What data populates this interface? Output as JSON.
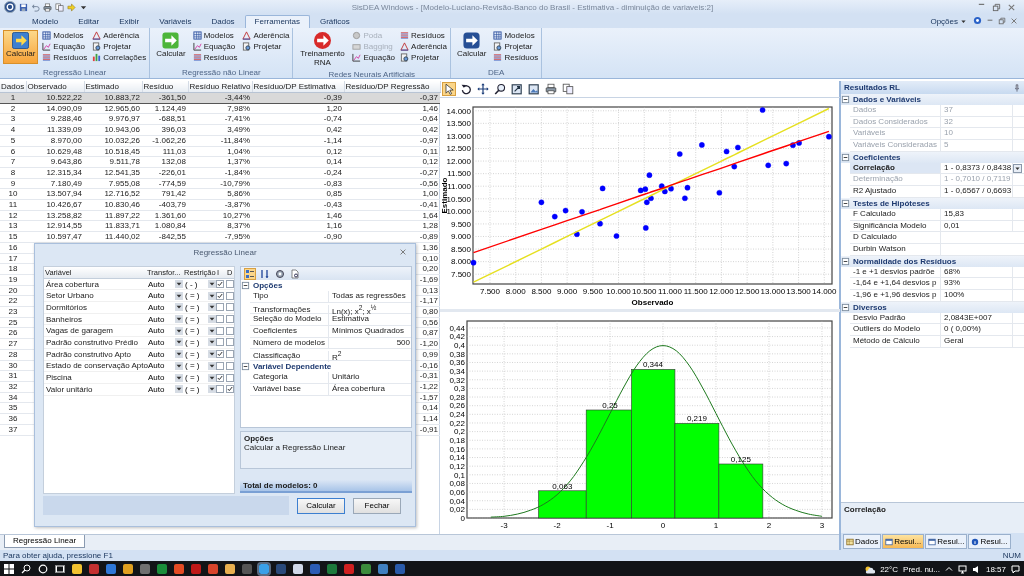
{
  "title_bar": {
    "title": "SisDEA Windows - [Modelo-Luciano-Revisão-Banco do Brasil - Estimativa - diminuição de variaveis:2]"
  },
  "ribbon": {
    "tabs": [
      {
        "label": "Modelo",
        "selected": false
      },
      {
        "label": "Editar",
        "selected": false
      },
      {
        "label": "Exibir",
        "selected": false
      },
      {
        "label": "Variáveis",
        "selected": false
      },
      {
        "label": "Dados",
        "selected": false
      },
      {
        "label": "Ferramentas",
        "selected": true
      },
      {
        "label": "Gráficos",
        "selected": false
      }
    ],
    "options_label": "Opções",
    "groups": [
      {
        "label": "Regressão Linear",
        "big": {
          "label": "Calcular",
          "kind": "square",
          "selected": true
        },
        "items": [
          {
            "label": "Modelos",
            "kind": "models",
            "disabled": false
          },
          {
            "label": "Equação",
            "kind": "equation",
            "disabled": false
          },
          {
            "label": "Resíduos",
            "kind": "residuals",
            "disabled": false
          },
          {
            "label": "Aderência",
            "kind": "adherence",
            "disabled": false
          },
          {
            "label": "Projetar",
            "kind": "project",
            "disabled": false
          },
          {
            "label": "Correlações",
            "kind": "correlations",
            "disabled": false
          }
        ]
      },
      {
        "label": "Regressão não Linear",
        "big": {
          "label": "Calcular",
          "kind": "plain",
          "selected": false
        },
        "items": [
          {
            "label": "Modelos",
            "kind": "models",
            "disabled": false
          },
          {
            "label": "Equação",
            "kind": "equation",
            "disabled": false
          },
          {
            "label": "Resíduos",
            "kind": "residuals",
            "disabled": false
          },
          {
            "label": "Aderência",
            "kind": "adherence",
            "disabled": false
          },
          {
            "label": "Projetar",
            "kind": "project",
            "disabled": false
          }
        ]
      },
      {
        "label": "Redes Neurais Artificiais",
        "big": {
          "label": "Treinamento RNA",
          "kind": "disc",
          "selected": false
        },
        "items": [
          {
            "label": "Poda",
            "kind": "prune",
            "disabled": true
          },
          {
            "label": "Bagging",
            "kind": "bagging",
            "disabled": true
          },
          {
            "label": "Equação",
            "kind": "equation",
            "disabled": false
          },
          {
            "label": "Resíduos",
            "kind": "residuals",
            "disabled": false
          },
          {
            "label": "Aderência",
            "kind": "adherence",
            "disabled": false
          },
          {
            "label": "Projetar",
            "kind": "project",
            "disabled": false
          }
        ]
      },
      {
        "label": "DEA",
        "big": {
          "label": "Calcular",
          "kind": "shield",
          "selected": false
        },
        "items": [
          {
            "label": "Modelos",
            "kind": "models",
            "disabled": false
          },
          {
            "label": "Projetar",
            "kind": "project",
            "disabled": false
          },
          {
            "label": "Resíduos",
            "kind": "residuals",
            "disabled": false
          }
        ]
      }
    ]
  },
  "table": {
    "columns": [
      "Dados",
      "Observado",
      "Estimado",
      "Resíduo",
      "Resíduo Relativo",
      "Resíduo/DP Estimativa",
      "Resíduo/DP Regressão"
    ],
    "rows": [
      {
        "dados": "1",
        "cells": [
          "10.522,22",
          "10.883,72",
          "-361,50",
          "-3,44%",
          "-0,39"
        ],
        "dp_regressao": "-0,37",
        "selected": true
      },
      {
        "dados": "2",
        "cells": [
          "14.090,09",
          "12.965,60",
          "1.124,49",
          "7,98%",
          "1,20"
        ],
        "dp_regressao": "1,46",
        "selected": false
      },
      {
        "dados": "3",
        "cells": [
          "9.288,46",
          "9.976,97",
          "-688,51",
          "-7,41%",
          "-0,74"
        ],
        "dp_regressao": "-0,64",
        "selected": false
      },
      {
        "dados": "4",
        "cells": [
          "11.339,09",
          "10.943,06",
          "396,03",
          "3,49%",
          "0,42"
        ],
        "dp_regressao": "0,42",
        "selected": false
      },
      {
        "dados": "5",
        "cells": [
          "8.970,00",
          "10.032,26",
          "-1.062,26",
          "-11,84%",
          "-1,14"
        ],
        "dp_regressao": "-0,97",
        "selected": false
      },
      {
        "dados": "6",
        "cells": [
          "10.629,48",
          "10.518,45",
          "111,03",
          "1,04%",
          "0,12"
        ],
        "dp_regressao": "0,11",
        "selected": false
      },
      {
        "dados": "7",
        "cells": [
          "9.643,86",
          "9.511,78",
          "132,08",
          "1,37%",
          "0,14"
        ],
        "dp_regressao": "0,12",
        "selected": false
      },
      {
        "dados": "8",
        "cells": [
          "12.315,34",
          "12.541,35",
          "-226,01",
          "-1,84%",
          "-0,24"
        ],
        "dp_regressao": "-0,27",
        "selected": false
      },
      {
        "dados": "9",
        "cells": [
          "7.180,49",
          "7.955,08",
          "-774,59",
          "-10,79%",
          "-0,83"
        ],
        "dp_regressao": "-0,56",
        "selected": false
      },
      {
        "dados": "10",
        "cells": [
          "13.507,94",
          "12.716,52",
          "791,42",
          "5,86%",
          "0,85"
        ],
        "dp_regressao": "1,00",
        "selected": false
      },
      {
        "dados": "11",
        "cells": [
          "10.426,67",
          "10.830,46",
          "-403,79",
          "-3,87%",
          "-0,43"
        ],
        "dp_regressao": "-0,41",
        "selected": false
      },
      {
        "dados": "12",
        "cells": [
          "13.258,82",
          "11.897,22",
          "1.361,60",
          "10,27%",
          "1,46"
        ],
        "dp_regressao": "1,64",
        "selected": false
      },
      {
        "dados": "13",
        "cells": [
          "12.914,55",
          "11.833,71",
          "1.080,84",
          "8,37%",
          "1,16"
        ],
        "dp_regressao": "1,28",
        "selected": false
      },
      {
        "dados": "15",
        "cells": [
          "10.597,47",
          "11.440,02",
          "-842,55",
          "-7,95%",
          "-0,90"
        ],
        "dp_regressao": "-0,89",
        "selected": false
      },
      {
        "dados": "16",
        "dp_regressao": "1,36",
        "selected": false
      },
      {
        "dados": "17",
        "dp_regressao": "0,10",
        "selected": false
      },
      {
        "dados": "18",
        "dp_regressao": "0,20",
        "selected": false
      },
      {
        "dados": "19",
        "dp_regressao": "-1,69",
        "selected": false
      },
      {
        "dados": "20",
        "dp_regressao": "0,13",
        "selected": false
      },
      {
        "dados": "22",
        "dp_regressao": "-1,17",
        "selected": false
      },
      {
        "dados": "23",
        "dp_regressao": "0,80",
        "selected": false
      },
      {
        "dados": "25",
        "dp_regressao": "0,56",
        "selected": false
      },
      {
        "dados": "26",
        "dp_regressao": "0,87",
        "selected": false
      },
      {
        "dados": "27",
        "dp_regressao": "-1,20",
        "selected": false
      },
      {
        "dados": "28",
        "dp_regressao": "0,99",
        "selected": false
      },
      {
        "dados": "30",
        "dp_regressao": "-0,16",
        "selected": false
      },
      {
        "dados": "31",
        "dp_regressao": "-0,31",
        "selected": false
      },
      {
        "dados": "32",
        "dp_regressao": "-1,22",
        "selected": false
      },
      {
        "dados": "34",
        "dp_regressao": "-1,57",
        "selected": false
      },
      {
        "dados": "35",
        "dp_regressao": "0,14",
        "selected": false
      },
      {
        "dados": "36",
        "dp_regressao": "1,14",
        "selected": false
      },
      {
        "dados": "37",
        "dp_regressao": "-0,91",
        "selected": false
      }
    ]
  },
  "dialog": {
    "title": "Regressão Linear",
    "columns": [
      "Variável",
      "Transfor...",
      "Restrição",
      "I",
      "D"
    ],
    "variables": [
      {
        "name": "Área cobertura",
        "transform": "Auto",
        "restriction": "( - )",
        "i": true,
        "d": false
      },
      {
        "name": "Setor Urbano",
        "transform": "Auto",
        "restriction": "( = )",
        "i": true,
        "d": false
      },
      {
        "name": "Dormitórios",
        "transform": "Auto",
        "restriction": "( = )",
        "i": false,
        "d": false
      },
      {
        "name": "Banheiros",
        "transform": "Auto",
        "restriction": "( = )",
        "i": false,
        "d": false
      },
      {
        "name": "Vagas de garagem",
        "transform": "Auto",
        "restriction": "( = )",
        "i": false,
        "d": false
      },
      {
        "name": "Padrão construtivo Prédio",
        "transform": "Auto",
        "restriction": "( = )",
        "i": false,
        "d": false
      },
      {
        "name": "Padrão construtivo Apto",
        "transform": "Auto",
        "restriction": "( = )",
        "i": true,
        "d": false
      },
      {
        "name": "Estado de conservação Apto",
        "transform": "Auto",
        "restriction": "( = )",
        "i": false,
        "d": false
      },
      {
        "name": "Piscina",
        "transform": "Auto",
        "restriction": "( = )",
        "i": true,
        "d": false
      },
      {
        "name": "Valor unitário",
        "transform": "Auto",
        "restriction": "( = )",
        "i": false,
        "d": true
      }
    ],
    "tools": [
      {
        "kind": "categorized",
        "selected": true
      },
      {
        "kind": "alphabetical",
        "selected": false
      },
      {
        "kind": "properties",
        "selected": false
      },
      {
        "kind": "pages",
        "selected": false
      }
    ],
    "sections": [
      {
        "title": "Opções",
        "rows": [
          {
            "label": "Tipo",
            "value": "Todas as regressões",
            "kind": "text"
          },
          {
            "label": "Transformações",
            "value": "Ln(x); x$^{2}$; x$^{½}$",
            "kind": "text"
          },
          {
            "label": "Seleção do Modelo",
            "value": "Estimativa",
            "kind": "text"
          },
          {
            "label": "Coeficientes",
            "value": "Mínimos Quadrados",
            "kind": "text"
          },
          {
            "label": "Número de modelos",
            "value": "500",
            "kind": "number"
          },
          {
            "label": "Classificação",
            "value": "R$^{2}$",
            "kind": "text"
          }
        ]
      },
      {
        "title": "Variável Dependente",
        "rows": [
          {
            "label": "Categoria",
            "value": "Unitário",
            "kind": "text"
          },
          {
            "label": "Variável base",
            "value": "Área cobertura",
            "kind": "text"
          }
        ]
      }
    ],
    "description_title": "Opções",
    "description": "Calcular a Regressão Linear",
    "total": "Total de modelos: 0",
    "buttons": [
      "Calcular",
      "Fechar"
    ]
  },
  "chart_tools": [
    {
      "kind": "pointer",
      "selected": true
    },
    {
      "kind": "rotate",
      "selected": false
    },
    {
      "kind": "move",
      "selected": false
    },
    {
      "kind": "zoom",
      "selected": false
    },
    {
      "kind": "export",
      "selected": false
    },
    {
      "kind": "image",
      "selected": false
    },
    {
      "kind": "print",
      "selected": false
    },
    {
      "kind": "copy",
      "selected": false
    }
  ],
  "scatter": {
    "chart_data": {
      "type": "scatter",
      "xlabel": "Observado",
      "ylabel": "Estimado",
      "grid": true,
      "x": [
        7180,
        8500,
        8760,
        8970,
        9190,
        9290,
        9640,
        9690,
        9960,
        10430,
        10520,
        10530,
        10550,
        10600,
        10630,
        10840,
        10900,
        11020,
        11190,
        11290,
        11340,
        11620,
        11960,
        12100,
        12250,
        12320,
        12800,
        12910,
        13260,
        13390,
        13510,
        14090
      ],
      "series": [
        {
          "type": "scatter",
          "color": "#0000ff",
          "values": [
            7960,
            10360,
            9790,
            10030,
            9090,
            9980,
            9510,
            10910,
            9020,
            10830,
            10880,
            9340,
            10360,
            11440,
            10520,
            11000,
            10790,
            10900,
            12280,
            10520,
            10940,
            12640,
            10740,
            12380,
            11780,
            12540,
            14030,
            11830,
            11900,
            12630,
            12720,
            12970
          ]
        },
        {
          "type": "line",
          "color": "#e6e020",
          "values": [
            7180,
            8500,
            8760,
            8970,
            9190,
            9290,
            9640,
            9690,
            9960,
            10430,
            10520,
            10530,
            10550,
            10600,
            10630,
            10840,
            10900,
            11020,
            11190,
            11290,
            11340,
            11620,
            11960,
            12100,
            12250,
            12320,
            12800,
            12910,
            13260,
            13390,
            13510,
            14090
          ]
        },
        {
          "type": "line",
          "color": "#ff0000",
          "values": [
            8360,
            9280,
            9460,
            9610,
            9760,
            9830,
            10070,
            10110,
            10300,
            10630,
            10690,
            10700,
            10710,
            10740,
            10770,
            10910,
            10950,
            11040,
            11160,
            11230,
            11260,
            11460,
            11690,
            11790,
            11900,
            11950,
            12280,
            12360,
            12600,
            12690,
            12780,
            13180
          ]
        }
      ],
      "xlim": [
        7170,
        14150
      ],
      "ylim": [
        7110,
        14150
      ],
      "xticks": [
        {
          "value": 7500,
          "label": "7.500"
        },
        {
          "value": 8000,
          "label": "8.000"
        },
        {
          "value": 8500,
          "label": "8.500"
        },
        {
          "value": 9000,
          "label": "9.000"
        },
        {
          "value": 9500,
          "label": "9.500"
        },
        {
          "value": 10000,
          "label": "10.000"
        },
        {
          "value": 10500,
          "label": "10.500"
        },
        {
          "value": 11000,
          "label": "11.000"
        },
        {
          "value": 11500,
          "label": "11.500"
        },
        {
          "value": 12000,
          "label": "12.000"
        },
        {
          "value": 12500,
          "label": "12.500"
        },
        {
          "value": 13000,
          "label": "13.000"
        },
        {
          "value": 13500,
          "label": "13.500"
        },
        {
          "value": 14000,
          "label": "14.000"
        }
      ],
      "yticks": [
        {
          "value": 7500,
          "label": "7.500"
        },
        {
          "value": 8000,
          "label": "8.000"
        },
        {
          "value": 8500,
          "label": "8.500"
        },
        {
          "value": 9000,
          "label": "9.000"
        },
        {
          "value": 9500,
          "label": "9.500"
        },
        {
          "value": 10000,
          "label": "10.000"
        },
        {
          "value": 10500,
          "label": "10.500"
        },
        {
          "value": 11000,
          "label": "11.000"
        },
        {
          "value": 11500,
          "label": "11.500"
        },
        {
          "value": 12000,
          "label": "12.000"
        },
        {
          "value": 12500,
          "label": "12.500"
        },
        {
          "value": 13000,
          "label": "13.000"
        },
        {
          "value": 13500,
          "label": "13.500"
        },
        {
          "value": 14000,
          "label": "14.000"
        }
      ]
    }
  },
  "histogram": {
    "chart_data": {
      "type": "bar",
      "grid": true,
      "series": [
        {
          "type": "bar",
          "color": "#00ff00",
          "x": [
            -1.9,
            -1.0,
            -0.19,
            0.64,
            1.47
          ],
          "values": [
            0.063,
            0.25,
            0.344,
            0.219,
            0.125
          ]
        },
        {
          "type": "line",
          "color": "#1e7a1e",
          "x": [
            -3.25,
            -3,
            -2.75,
            -2.5,
            -2.25,
            -2,
            -1.75,
            -1.5,
            -1.25,
            -1,
            -0.75,
            -0.5,
            -0.25,
            0,
            0.25,
            0.5,
            0.75,
            1,
            1.25,
            1.5,
            1.75,
            2,
            2.25,
            2.5,
            2.75,
            3
          ],
          "values": [
            0.002,
            0.004,
            0.009,
            0.018,
            0.032,
            0.054,
            0.086,
            0.13,
            0.183,
            0.242,
            0.301,
            0.352,
            0.387,
            0.399,
            0.387,
            0.352,
            0.301,
            0.242,
            0.183,
            0.13,
            0.086,
            0.054,
            0.032,
            0.018,
            0.009,
            0.004
          ]
        }
      ],
      "value_labels": [
        "0,063",
        "0,25",
        "0,344",
        "0,219",
        "0,125"
      ],
      "xlim": [
        -3.7,
        3.19
      ],
      "ylim": [
        0,
        0.456
      ],
      "xticks": [
        -3,
        -2,
        -1,
        0,
        1,
        2,
        3
      ],
      "yticks": [
        {
          "value": 0,
          "label": "0"
        },
        {
          "value": 0.02,
          "label": "0,02"
        },
        {
          "value": 0.04,
          "label": "0,04"
        },
        {
          "value": 0.06,
          "label": "0,06"
        },
        {
          "value": 0.08,
          "label": "0,08"
        },
        {
          "value": 0.1,
          "label": "0,1"
        },
        {
          "value": 0.12,
          "label": "0,12"
        },
        {
          "value": 0.14,
          "label": "0,14"
        },
        {
          "value": 0.16,
          "label": "0,16"
        },
        {
          "value": 0.18,
          "label": "0,18"
        },
        {
          "value": 0.2,
          "label": "0,2"
        },
        {
          "value": 0.22,
          "label": "0,22"
        },
        {
          "value": 0.24,
          "label": "0,24"
        },
        {
          "value": 0.26,
          "label": "0,26"
        },
        {
          "value": 0.28,
          "label": "0,28"
        },
        {
          "value": 0.3,
          "label": "0,3"
        },
        {
          "value": 0.32,
          "label": "0,32"
        },
        {
          "value": 0.34,
          "label": "0,34"
        },
        {
          "value": 0.36,
          "label": "0,36"
        },
        {
          "value": 0.38,
          "label": "0,38"
        },
        {
          "value": 0.4,
          "label": "0,4"
        },
        {
          "value": 0.42,
          "label": "0,42"
        },
        {
          "value": 0.44,
          "label": "0,44"
        }
      ]
    }
  },
  "right_panel": {
    "title": "Resultados RL",
    "sections": [
      {
        "title": "Dados e Variáveis",
        "rows": [
          {
            "label": "Dados",
            "value": "37",
            "disabled": true,
            "selected": false
          },
          {
            "label": "Dados Considerados",
            "value": "32",
            "disabled": true,
            "selected": false
          },
          {
            "label": "Variáveis",
            "value": "10",
            "disabled": true,
            "selected": false
          },
          {
            "label": "Variáveis Consideradas",
            "value": "5",
            "disabled": true,
            "selected": false
          }
        ]
      },
      {
        "title": "Coeficientes",
        "rows": [
          {
            "label": "Correlação",
            "value": "1 - 0,8373 / 0,8438",
            "disabled": false,
            "selected": true
          },
          {
            "label": "Determinação",
            "value": "1 - 0,7010 / 0,7119",
            "disabled": true,
            "selected": false
          },
          {
            "label": "R2 Ajustado",
            "value": "1 - 0,6567 / 0,6693",
            "disabled": false,
            "selected": false
          }
        ]
      },
      {
        "title": "Testes de Hipóteses",
        "rows": [
          {
            "label": "F Calculado",
            "value": "15,83",
            "disabled": false,
            "selected": false
          },
          {
            "label": "Significância Modelo",
            "value": "0,01",
            "disabled": false,
            "selected": false
          },
          {
            "label": "D Calculado",
            "disabled": false,
            "selected": false
          },
          {
            "label": "Durbin Watson",
            "disabled": false,
            "selected": false
          }
        ]
      },
      {
        "title": "Normalidade dos Resíduos",
        "rows": [
          {
            "label": "-1 e +1 desvios padrõe",
            "value": "68%",
            "disabled": false,
            "selected": false
          },
          {
            "label": "-1,64 e +1,64 desvios p",
            "value": "93%",
            "disabled": false,
            "selected": false
          },
          {
            "label": "-1,96 e +1,96 desvios p",
            "value": "100%",
            "disabled": false,
            "selected": false
          }
        ]
      },
      {
        "title": "Diversos",
        "rows": [
          {
            "label": "Desvio Padrão",
            "value": "2,0843E+007",
            "disabled": false,
            "selected": false
          },
          {
            "label": "Outliers do Modelo",
            "value": "0   ( 0,00%)",
            "disabled": false,
            "selected": false
          },
          {
            "label": "Método de Cálculo",
            "value": "Geral",
            "disabled": false,
            "selected": false
          }
        ]
      }
    ],
    "description_title": "Correlação",
    "tabs": [
      {
        "label": "Dados",
        "kind": "data",
        "selected": false
      },
      {
        "label": "Resul...",
        "kind": "results",
        "selected": true
      },
      {
        "label": "Resul...",
        "kind": "results",
        "selected": false
      },
      {
        "label": "Resul...",
        "kind": "info",
        "selected": false
      }
    ]
  },
  "document_tabs": [
    {
      "label": "Regressão Linear",
      "selected": true
    }
  ],
  "status_bar": {
    "text": "Para obter ajuda, pressione F1",
    "indicator": "NUM"
  },
  "taskbar": {
    "temperature": "22°C",
    "forecast": "Pred. nu...",
    "time": "18:57"
  }
}
